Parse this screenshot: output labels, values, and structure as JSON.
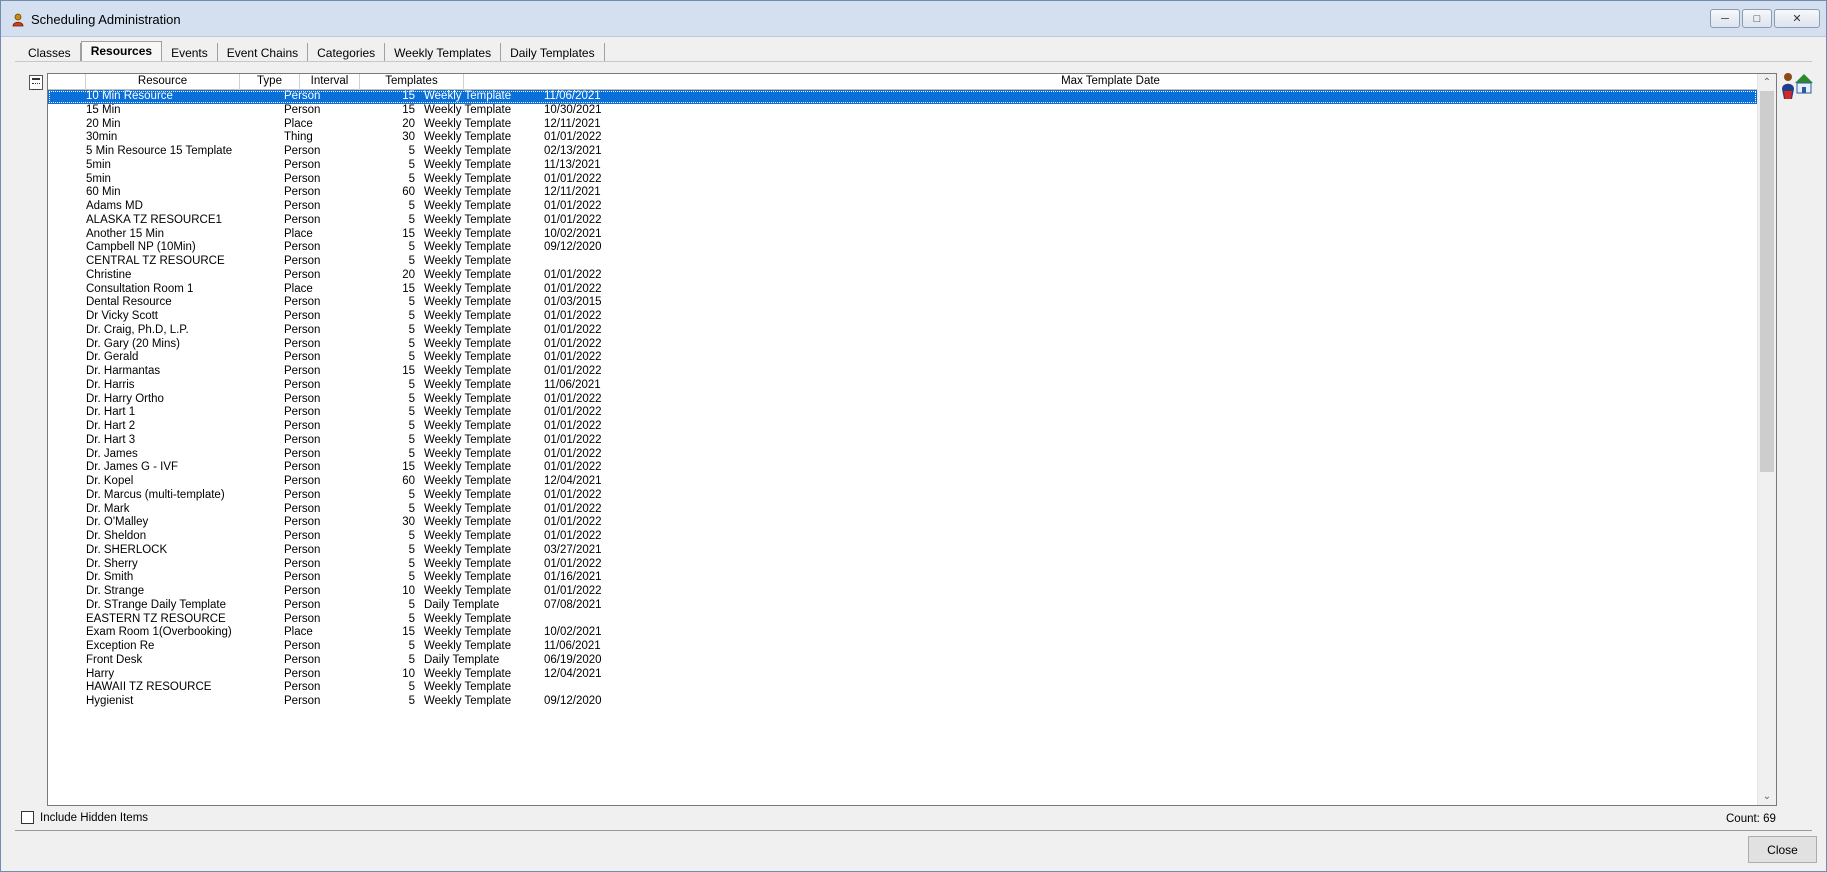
{
  "window": {
    "title": "Scheduling Administration"
  },
  "tabs": [
    {
      "label": "Classes",
      "active": false
    },
    {
      "label": "Resources",
      "active": true
    },
    {
      "label": "Events",
      "active": false
    },
    {
      "label": "Event Chains",
      "active": false
    },
    {
      "label": "Categories",
      "active": false
    },
    {
      "label": "Weekly Templates",
      "active": false
    },
    {
      "label": "Daily Templates",
      "active": false
    }
  ],
  "grid": {
    "columns": [
      "Resource",
      "Type",
      "Interval",
      "Templates",
      "Max Template Date"
    ],
    "rows": [
      [
        "10 Min Resource",
        "Person",
        "15",
        "Weekly Template",
        "11/06/2021"
      ],
      [
        "15 Min",
        "Person",
        "15",
        "Weekly Template",
        "10/30/2021"
      ],
      [
        "20 Min",
        "Place",
        "20",
        "Weekly Template",
        "12/11/2021"
      ],
      [
        "30min",
        "Thing",
        "30",
        "Weekly Template",
        "01/01/2022"
      ],
      [
        "5 Min Resource 15 Template",
        "Person",
        "5",
        "Weekly Template",
        "02/13/2021"
      ],
      [
        "5min",
        "Person",
        "5",
        "Weekly Template",
        "11/13/2021"
      ],
      [
        "5min",
        "Person",
        "5",
        "Weekly Template",
        "01/01/2022"
      ],
      [
        "60 Min",
        "Person",
        "60",
        "Weekly Template",
        "12/11/2021"
      ],
      [
        "Adams MD",
        "Person",
        "5",
        "Weekly Template",
        "01/01/2022"
      ],
      [
        "ALASKA TZ RESOURCE1",
        "Person",
        "5",
        "Weekly Template",
        "01/01/2022"
      ],
      [
        "Another 15 Min",
        "Place",
        "15",
        "Weekly Template",
        "10/02/2021"
      ],
      [
        "Campbell NP (10Min)",
        "Person",
        "5",
        "Weekly Template",
        "09/12/2020"
      ],
      [
        "CENTRAL TZ RESOURCE",
        "Person",
        "5",
        "Weekly Template",
        ""
      ],
      [
        "Christine",
        "Person",
        "20",
        "Weekly Template",
        "01/01/2022"
      ],
      [
        "Consultation Room 1",
        "Place",
        "15",
        "Weekly Template",
        "01/01/2022"
      ],
      [
        "Dental Resource",
        "Person",
        "5",
        "Weekly Template",
        "01/03/2015"
      ],
      [
        "Dr Vicky Scott",
        "Person",
        "5",
        "Weekly Template",
        "01/01/2022"
      ],
      [
        "Dr. Craig, Ph.D, L.P.",
        "Person",
        "5",
        "Weekly Template",
        "01/01/2022"
      ],
      [
        "Dr. Gary (20 Mins)",
        "Person",
        "5",
        "Weekly Template",
        "01/01/2022"
      ],
      [
        "Dr. Gerald",
        "Person",
        "5",
        "Weekly Template",
        "01/01/2022"
      ],
      [
        "Dr. Harmantas",
        "Person",
        "15",
        "Weekly Template",
        "01/01/2022"
      ],
      [
        "Dr. Harris",
        "Person",
        "5",
        "Weekly Template",
        "11/06/2021"
      ],
      [
        "Dr. Harry Ortho",
        "Person",
        "5",
        "Weekly Template",
        "01/01/2022"
      ],
      [
        "Dr. Hart 1",
        "Person",
        "5",
        "Weekly Template",
        "01/01/2022"
      ],
      [
        "Dr. Hart 2",
        "Person",
        "5",
        "Weekly Template",
        "01/01/2022"
      ],
      [
        "Dr. Hart 3",
        "Person",
        "5",
        "Weekly Template",
        "01/01/2022"
      ],
      [
        "Dr. James",
        "Person",
        "5",
        "Weekly Template",
        "01/01/2022"
      ],
      [
        "Dr. James G - IVF",
        "Person",
        "15",
        "Weekly Template",
        "01/01/2022"
      ],
      [
        "Dr. Kopel",
        "Person",
        "60",
        "Weekly Template",
        "12/04/2021"
      ],
      [
        "Dr. Marcus (multi-template)",
        "Person",
        "5",
        "Weekly Template",
        "01/01/2022"
      ],
      [
        "Dr. Mark",
        "Person",
        "5",
        "Weekly Template",
        "01/01/2022"
      ],
      [
        "Dr. O'Malley",
        "Person",
        "30",
        "Weekly Template",
        "01/01/2022"
      ],
      [
        "Dr. Sheldon",
        "Person",
        "5",
        "Weekly Template",
        "01/01/2022"
      ],
      [
        "Dr. SHERLOCK",
        "Person",
        "5",
        "Weekly Template",
        "03/27/2021"
      ],
      [
        "Dr. Sherry",
        "Person",
        "5",
        "Weekly Template",
        "01/01/2022"
      ],
      [
        "Dr. Smith",
        "Person",
        "5",
        "Weekly Template",
        "01/16/2021"
      ],
      [
        "Dr. Strange",
        "Person",
        "10",
        "Weekly Template",
        "01/01/2022"
      ],
      [
        "Dr. STrange Daily Template",
        "Person",
        "5",
        "Daily Template",
        "07/08/2021"
      ],
      [
        "EASTERN TZ RESOURCE",
        "Person",
        "5",
        "Weekly Template",
        ""
      ],
      [
        "Exam Room 1(Overbooking)",
        "Place",
        "15",
        "Weekly Template",
        "10/02/2021"
      ],
      [
        "Exception Re",
        "Person",
        "5",
        "Weekly Template",
        "11/06/2021"
      ],
      [
        "Front Desk",
        "Person",
        "5",
        "Daily Template",
        "06/19/2020"
      ],
      [
        "Harry",
        "Person",
        "10",
        "Weekly Template",
        "12/04/2021"
      ],
      [
        "HAWAII TZ RESOURCE",
        "Person",
        "5",
        "Weekly Template",
        ""
      ],
      [
        "Hygienist",
        "Person",
        "5",
        "Weekly Template",
        "09/12/2020"
      ]
    ],
    "selected_index": 0
  },
  "footer": {
    "include_hidden_label": "Include Hidden Items",
    "include_hidden_checked": false,
    "count_text": "Count: 69",
    "close_label": "Close"
  },
  "colors": {
    "selection": "#0a6fd6",
    "titlebar": "#d4dff0"
  },
  "icons": {
    "title": "person-icon",
    "left_tool": "list-settings-icon",
    "right_tool": "person-home-icon"
  }
}
